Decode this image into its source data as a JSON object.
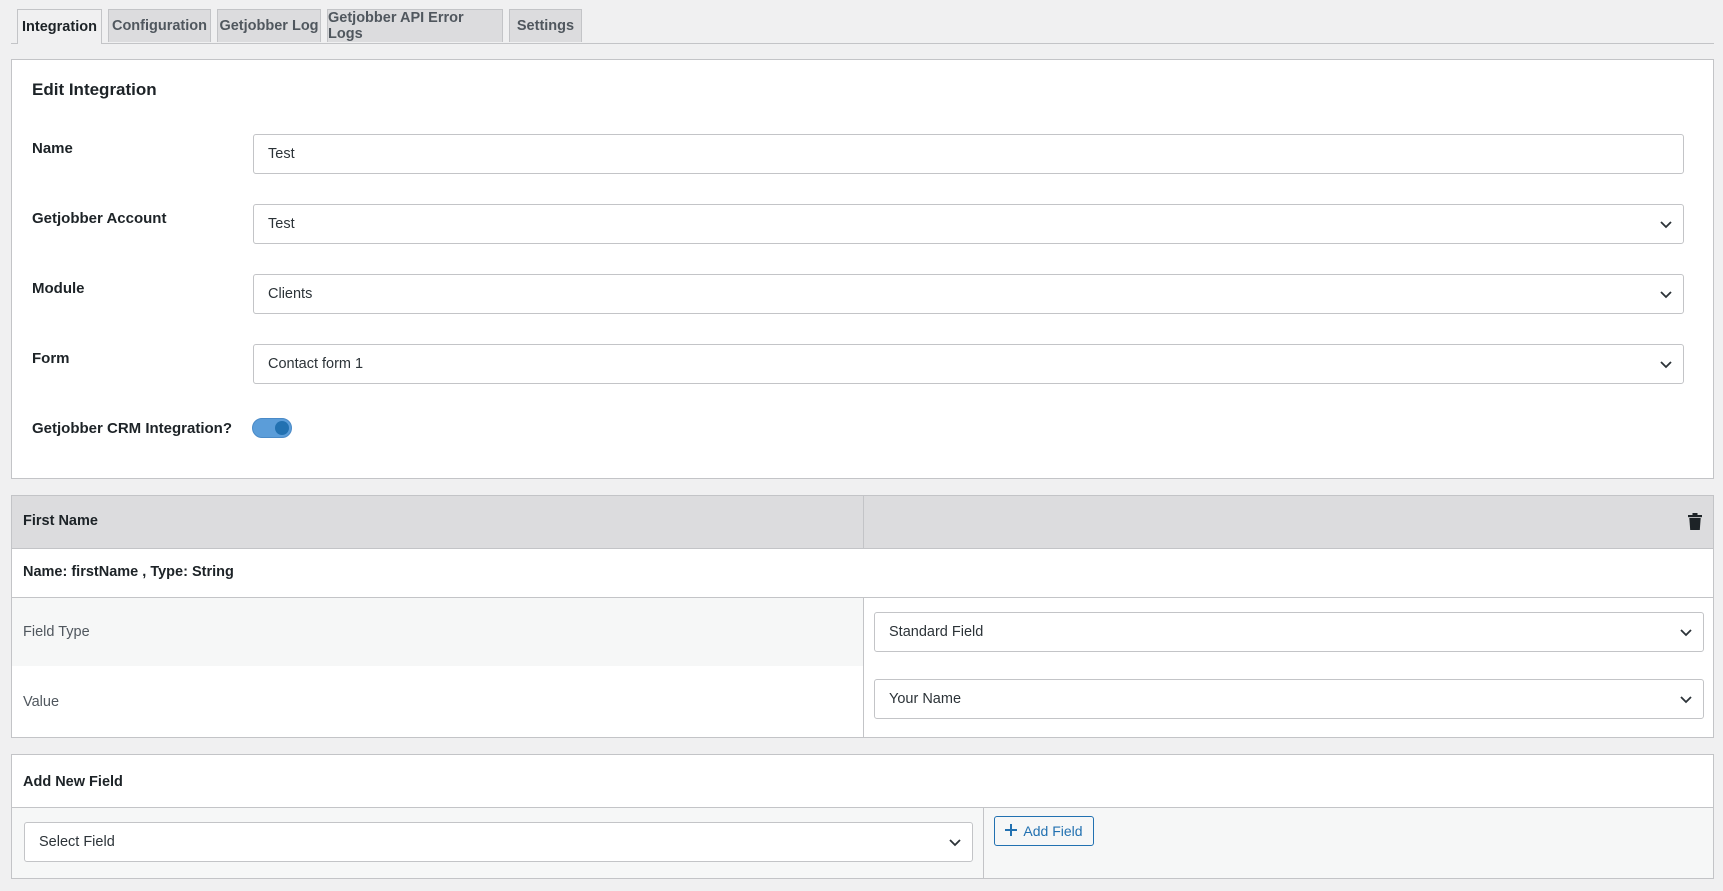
{
  "tabs": [
    {
      "label": "Integration",
      "active": true
    },
    {
      "label": "Configuration",
      "active": false
    },
    {
      "label": "Getjobber Log",
      "active": false
    },
    {
      "label": "Getjobber API Error Logs",
      "active": false
    },
    {
      "label": "Settings",
      "active": false
    }
  ],
  "edit": {
    "title": "Edit Integration",
    "name_label": "Name",
    "name_value": "Test",
    "account_label": "Getjobber Account",
    "account_value": "Test",
    "module_label": "Module",
    "module_value": "Clients",
    "form_label": "Form",
    "form_value": "Contact form 1",
    "crm_label": "Getjobber CRM Integration?",
    "crm_enabled": true
  },
  "field_mapping": {
    "title": "First Name",
    "meta": "Name: firstName , Type: String",
    "field_type_label": "Field Type",
    "field_type_value": "Standard Field",
    "value_label": "Value",
    "value_value": "Your Name"
  },
  "add_field": {
    "title": "Add New Field",
    "select_value": "Select Field",
    "button_label": "Add Field"
  },
  "colors": {
    "accent": "#2271b1",
    "toggle_track": "#5b9dd9",
    "header_bg": "#dcdcde"
  }
}
